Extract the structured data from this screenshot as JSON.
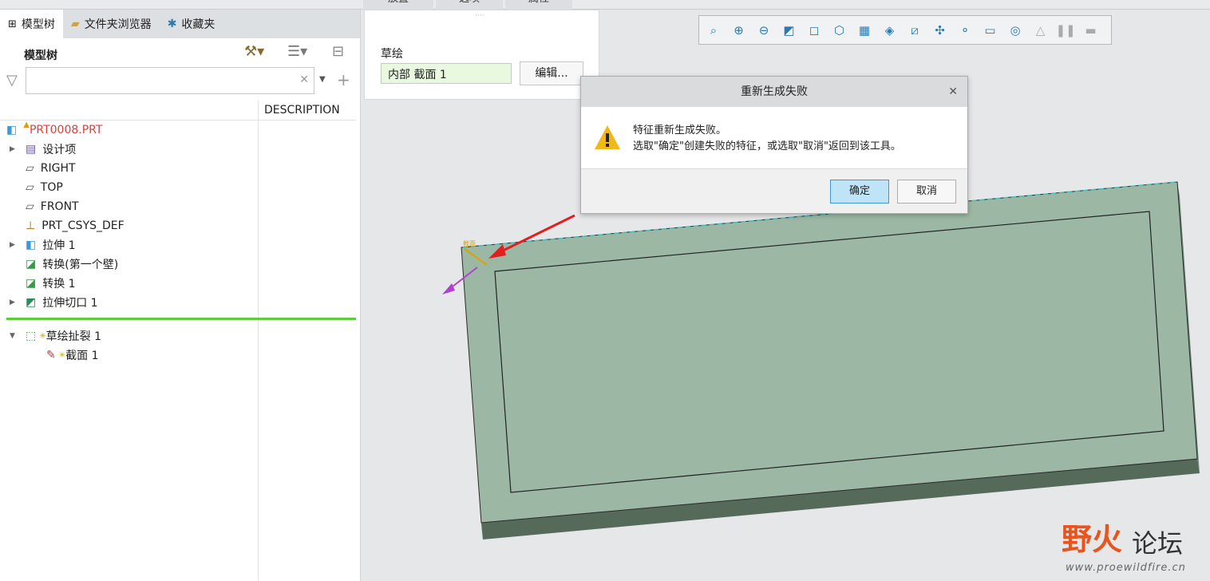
{
  "top_tabs": [
    "放置",
    "选项",
    "属性"
  ],
  "left_tabs": [
    {
      "label": "模型树",
      "icon": "model-tree-icon"
    },
    {
      "label": "文件夹浏览器",
      "icon": "folder-icon"
    },
    {
      "label": "收藏夹",
      "icon": "favorites-icon"
    }
  ],
  "model_tree": {
    "title": "模型树",
    "search_value": "",
    "column": "DESCRIPTION",
    "items": [
      {
        "label": "PRT0008.PRT",
        "icon": "part-icon",
        "expand": false
      },
      {
        "label": "设计项",
        "icon": "design-items-icon",
        "expand": true
      },
      {
        "label": "RIGHT",
        "icon": "datum-plane-icon",
        "expand": false
      },
      {
        "label": "TOP",
        "icon": "datum-plane-icon",
        "expand": false
      },
      {
        "label": "FRONT",
        "icon": "datum-plane-icon",
        "expand": false
      },
      {
        "label": "PRT_CSYS_DEF",
        "icon": "csys-icon",
        "expand": false
      },
      {
        "label": "拉伸 1",
        "icon": "extrude-icon",
        "expand": true
      },
      {
        "label": "转换(第一个壁)",
        "icon": "convert-icon",
        "expand": false
      },
      {
        "label": "转换 1",
        "icon": "convert-icon",
        "expand": false
      },
      {
        "label": "拉伸切口 1",
        "icon": "cut-icon",
        "expand": true
      }
    ],
    "insert_items": [
      {
        "label": "草绘扯裂 1",
        "icon": "sketch-rip-icon"
      },
      {
        "label": "截面 1",
        "icon": "section-icon"
      }
    ]
  },
  "placement": {
    "label": "草绘",
    "value": "内部 截面 1",
    "edit": "编辑..."
  },
  "view_toolbar": [
    "refit-icon",
    "zoom-in-icon",
    "zoom-out-icon",
    "repaint-icon",
    "display-style-icon",
    "saved-views-icon",
    "view-manager-icon",
    "perspective-icon",
    "section-icon",
    "datum-display-icon",
    "spin-center-icon",
    "annotation-display-icon",
    "appearance-icon",
    "regenerate-icon",
    "pause-icon",
    "next-icon"
  ],
  "dialog": {
    "title": "重新生成失败",
    "line1": "特征重新生成失败。",
    "line2": "选取\"确定\"创建失败的特征，或选取\"取消\"返回到该工具。",
    "ok": "确定",
    "cancel": "取消"
  },
  "watermark": {
    "text1": "野火",
    "text2": "论坛",
    "url": "www.proewildfire.cn"
  },
  "colors": {
    "face": "#9cb8a4",
    "side": "#5a6e5e",
    "error": "#e03c3c"
  }
}
